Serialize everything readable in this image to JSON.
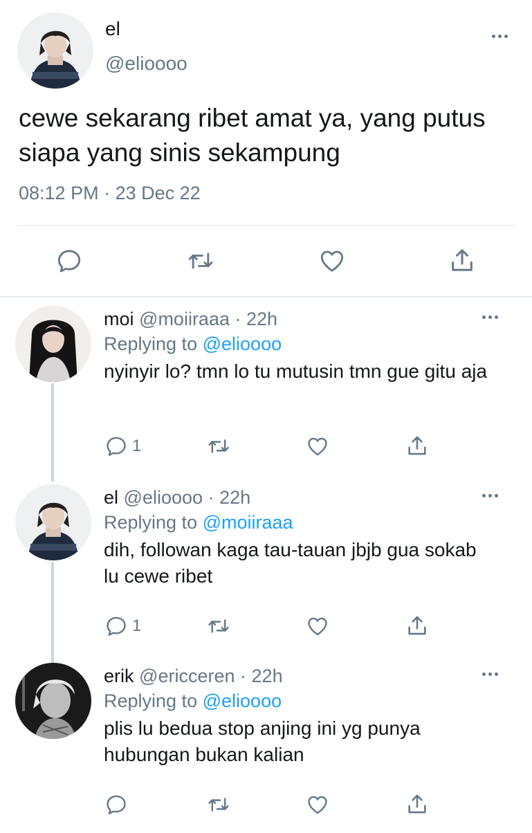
{
  "main_tweet": {
    "name": "el",
    "handle": "@elioooo",
    "text": "cewe sekarang ribet amat ya, yang putus siapa yang sinis sekampung",
    "time": "08:12 PM",
    "separator": "·",
    "date": "23 Dec 22"
  },
  "replies": [
    {
      "name": "moi",
      "handle": "@moiiraaa",
      "separator": "·",
      "time": "22h",
      "replying_prefix": "Replying to",
      "replying_to": "@elioooo",
      "text": "nyinyir lo? tmn lo tu mutusin tmn gue gitu aja",
      "reply_count": "1"
    },
    {
      "name": "el",
      "handle": "@elioooo",
      "separator": "·",
      "time": "22h",
      "replying_prefix": "Replying to",
      "replying_to": "@moiiraaa",
      "text": "dih, followan kaga tau-tauan jbjb gua sokab lu cewe ribet",
      "reply_count": "1"
    },
    {
      "name": "erik",
      "handle": "@ericceren",
      "separator": "·",
      "time": "22h",
      "replying_prefix": "Replying to",
      "replying_to": "@elioooo",
      "text": "plis lu bedua stop anjing ini yg punya hubungan bukan kalian",
      "reply_count": ""
    }
  ],
  "icons": {
    "reply": "speech-bubble-icon",
    "retweet": "retweet-icon",
    "like": "heart-icon",
    "share": "share-upload-icon",
    "more": "more-dots-icon"
  },
  "colors": {
    "text": "#14171a",
    "muted": "#657786",
    "link": "#1da1f2",
    "divider": "#e1e8ed",
    "thread_line": "#ccd6dd"
  }
}
